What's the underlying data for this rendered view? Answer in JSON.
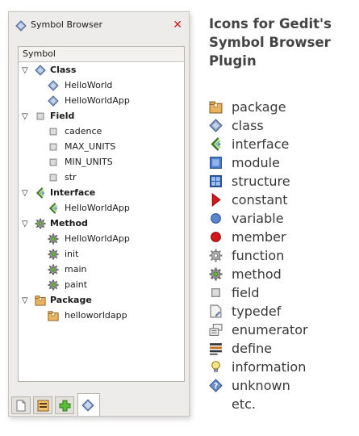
{
  "panel": {
    "title": "Symbol Browser",
    "column_header": "Symbol"
  },
  "tree": [
    {
      "type": "category",
      "label": "Class",
      "icon": "class-icon"
    },
    {
      "type": "item",
      "label": "HelloWorld",
      "icon": "class-icon"
    },
    {
      "type": "item",
      "label": "HelloWorldApp",
      "icon": "class-icon"
    },
    {
      "type": "category",
      "label": "Field",
      "icon": "field-icon"
    },
    {
      "type": "item",
      "label": "cadence",
      "icon": "field-icon"
    },
    {
      "type": "item",
      "label": "MAX_UNITS",
      "icon": "field-icon"
    },
    {
      "type": "item",
      "label": "MIN_UNITS",
      "icon": "field-icon"
    },
    {
      "type": "item",
      "label": "str",
      "icon": "field-icon"
    },
    {
      "type": "category",
      "label": "Interface",
      "icon": "interface-icon"
    },
    {
      "type": "item",
      "label": "HelloWorldApp",
      "icon": "interface-icon"
    },
    {
      "type": "category",
      "label": "Method",
      "icon": "method-icon"
    },
    {
      "type": "item",
      "label": "HelloWorldApp",
      "icon": "method-icon"
    },
    {
      "type": "item",
      "label": "init",
      "icon": "method-icon"
    },
    {
      "type": "item",
      "label": "main",
      "icon": "method-icon"
    },
    {
      "type": "item",
      "label": "paint",
      "icon": "method-icon"
    },
    {
      "type": "category",
      "label": "Package",
      "icon": "package-icon"
    },
    {
      "type": "item",
      "label": "helloworldapp",
      "icon": "package-icon"
    }
  ],
  "bottom_tabs": [
    {
      "icon": "document-icon",
      "active": false
    },
    {
      "icon": "tools-icon",
      "active": false
    },
    {
      "icon": "add-icon",
      "active": false
    },
    {
      "icon": "symbol-browser-icon",
      "active": true
    }
  ],
  "legend": {
    "title_lines": [
      "Icons for Gedit's",
      "Symbol Browser",
      "Plugin"
    ],
    "items": [
      {
        "label": "package",
        "icon": "package-icon"
      },
      {
        "label": "class",
        "icon": "class-icon"
      },
      {
        "label": "interface",
        "icon": "interface-icon"
      },
      {
        "label": "module",
        "icon": "module-icon"
      },
      {
        "label": "structure",
        "icon": "structure-icon"
      },
      {
        "label": "constant",
        "icon": "constant-icon"
      },
      {
        "label": "variable",
        "icon": "variable-icon"
      },
      {
        "label": "member",
        "icon": "member-icon"
      },
      {
        "label": "function",
        "icon": "function-icon"
      },
      {
        "label": "method",
        "icon": "method-icon"
      },
      {
        "label": "field",
        "icon": "field-icon"
      },
      {
        "label": "typedef",
        "icon": "typedef-icon"
      },
      {
        "label": "enumerator",
        "icon": "enumerator-icon"
      },
      {
        "label": "define",
        "icon": "define-icon"
      },
      {
        "label": "information",
        "icon": "information-icon"
      },
      {
        "label": "unknown",
        "icon": "unknown-icon"
      },
      {
        "label": "etc.",
        "icon": ""
      }
    ]
  }
}
